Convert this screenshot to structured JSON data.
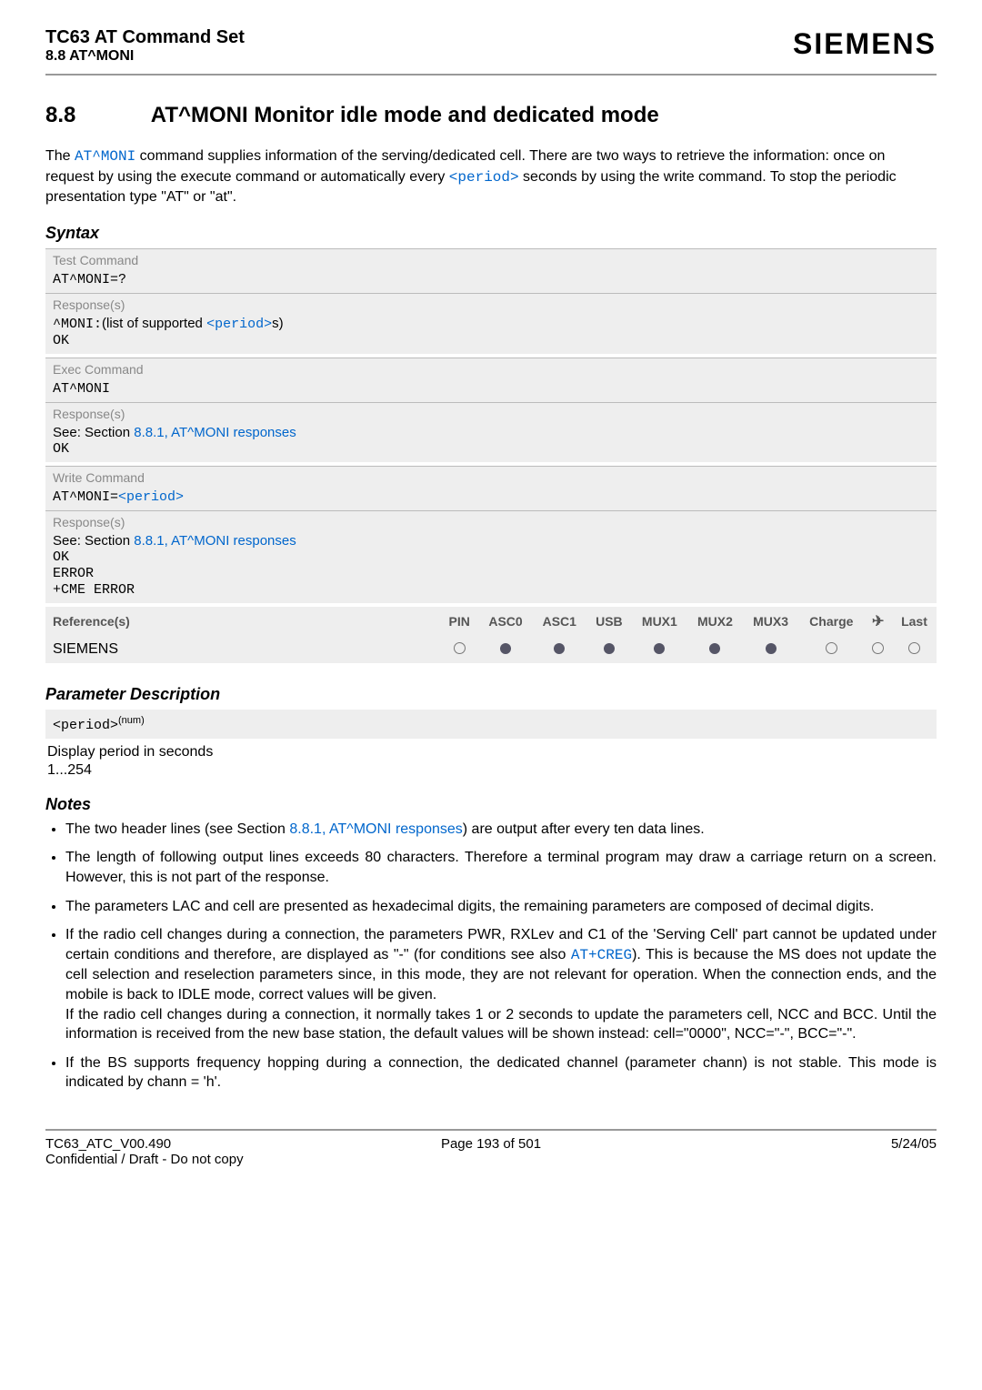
{
  "header": {
    "doc_title": "TC63 AT Command Set",
    "section_ref": "8.8 AT^MONI",
    "brand": "SIEMENS"
  },
  "section": {
    "number": "8.8",
    "title": "AT^MONI   Monitor idle mode and dedicated mode"
  },
  "intro": {
    "pre1": "The ",
    "cmd1": "AT^MONI",
    "mid1": " command supplies information of the serving/dedicated cell. There are two ways to retrieve the information: once on request by using the execute command or automatically every ",
    "cmd2": "<period>",
    "post1": " seconds by using the write command. To stop the periodic presentation type \"AT\" or \"at\"."
  },
  "syntax_label": "Syntax",
  "syntax": {
    "test": {
      "label": "Test Command",
      "cmd": "AT^MONI=?",
      "resp_label": "Response(s)",
      "resp_prefix": "^MONI:",
      "resp_mid": "(list of supported ",
      "resp_param": "<period>",
      "resp_suffix": "s)",
      "ok": "OK"
    },
    "exec": {
      "label": "Exec Command",
      "cmd": "AT^MONI",
      "resp_label": "Response(s)",
      "see_pre": "See: Section ",
      "see_link": "8.8.1, AT^MONI responses",
      "ok": "OK"
    },
    "write": {
      "label": "Write Command",
      "cmd_pre": "AT^MONI=",
      "cmd_param": "<period>",
      "resp_label": "Response(s)",
      "see_pre": "See: Section ",
      "see_link": "8.8.1, AT^MONI responses",
      "ok": "OK",
      "err": "ERROR",
      "cme": "+CME ERROR"
    }
  },
  "ref": {
    "label": "Reference(s)",
    "cols": [
      "PIN",
      "ASC0",
      "ASC1",
      "USB",
      "MUX1",
      "MUX2",
      "MUX3",
      "Charge",
      "",
      "Last"
    ],
    "vendor": "SIEMENS"
  },
  "param_desc_label": "Parameter Description",
  "param": {
    "name": "<period>",
    "sup": "(num)",
    "desc": "Display period in seconds",
    "range": "1...254"
  },
  "notes_label": "Notes",
  "notes": {
    "n1a": "The two header lines (see Section ",
    "n1link": "8.8.1, AT^MONI responses",
    "n1b": ") are output after every ten data lines.",
    "n2": "The length of following output lines exceeds 80 characters. Therefore a terminal program may draw a carriage return on a screen. However, this is not part of the response.",
    "n3": "The parameters LAC and cell are presented as hexadecimal digits, the remaining parameters are composed of decimal digits.",
    "n4a": "If the radio cell changes during a connection, the parameters PWR, RXLev and C1 of the 'Serving Cell' part cannot be updated under certain conditions and therefore, are displayed as \"-\" (for conditions see also ",
    "n4cmd": "AT+CREG",
    "n4b": "). This is because the MS does not update the cell selection and reselection parameters since, in this mode, they are not relevant for operation. When the connection ends, and the mobile is back to IDLE mode, correct values will be given.",
    "n4c": "If the radio cell changes during a connection, it normally takes 1 or 2 seconds to update the parameters cell, NCC and BCC. Until the information is received from the new base station, the default values will be shown instead: cell=\"0000\", NCC=\"-\", BCC=\"-\".",
    "n5": "If the BS supports frequency hopping during a connection, the dedicated channel (parameter chann) is not stable. This mode is indicated by chann = 'h'."
  },
  "footer": {
    "left1": "TC63_ATC_V00.490",
    "left2": "Confidential / Draft - Do not copy",
    "mid": "Page 193 of 501",
    "right": "5/24/05"
  }
}
